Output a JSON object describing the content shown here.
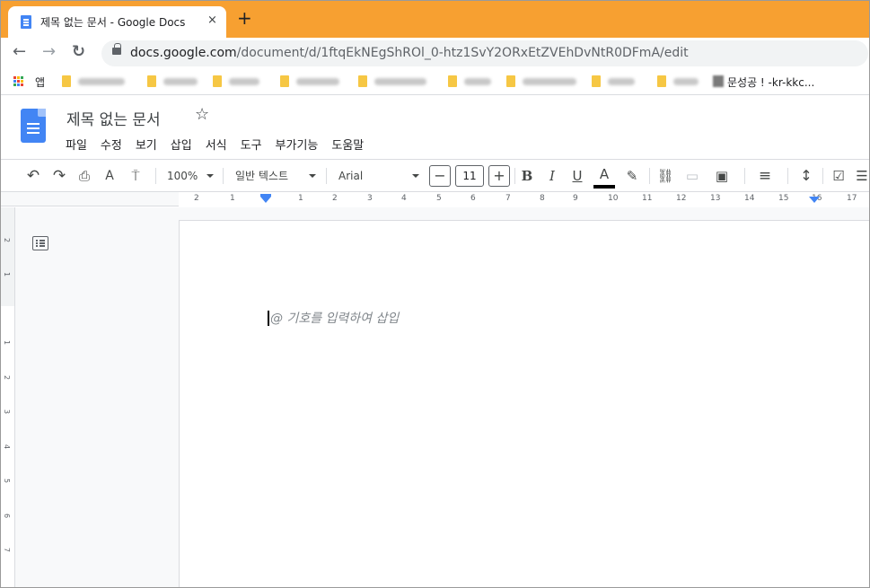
{
  "browser": {
    "tab_title": "제목 없는 문서 - Google Docs",
    "tab_close": "×",
    "new_tab": "+",
    "url_host": "docs.google.com",
    "url_path": "/document/d/1ftqEkNEgShROl_0-htz1SvY2ORxEtZVEhDvNtR0DFmA/edit",
    "nav": {
      "back": "←",
      "forward": "→",
      "reload": "↻"
    }
  },
  "bookmarks": {
    "apps_label": "앱",
    "last_label": "문성공 ! -kr-kkc..."
  },
  "docs": {
    "title": "제목 없는 문서",
    "star": "☆",
    "menu": [
      "파일",
      "수정",
      "보기",
      "삽입",
      "서식",
      "도구",
      "부가기능",
      "도움말"
    ]
  },
  "toolbar": {
    "undo": "↶",
    "redo": "↷",
    "print": "⎙",
    "spellcheck": "A",
    "paint_format": "⍑",
    "zoom": "100%",
    "style": "일반 텍스트",
    "font": "Arial",
    "font_size": "11",
    "minus": "−",
    "plus": "+",
    "bold": "B",
    "italic": "I",
    "underline": "U",
    "text_color": "A",
    "highlight": "✎",
    "link": "⛓",
    "comment": "▭",
    "image": "▣",
    "align": "≡",
    "line_spacing": "↕",
    "checklist": "☑",
    "bullets": "☰"
  },
  "ruler": {
    "labels": [
      "2",
      "1",
      "1",
      "2",
      "3",
      "4",
      "5",
      "6",
      "7",
      "8",
      "9",
      "10",
      "11",
      "12",
      "13",
      "14",
      "15",
      "16",
      "17"
    ]
  },
  "vruler": {
    "labels": [
      "2",
      "1",
      "1",
      "2",
      "3",
      "4",
      "5",
      "6",
      "7"
    ]
  },
  "document": {
    "placeholder": "@ 기호를 입력하여 삽입"
  },
  "colors": {
    "tabstrip": "#f7a031",
    "docs_blue": "#4285f4",
    "folder": "#f6c744"
  }
}
